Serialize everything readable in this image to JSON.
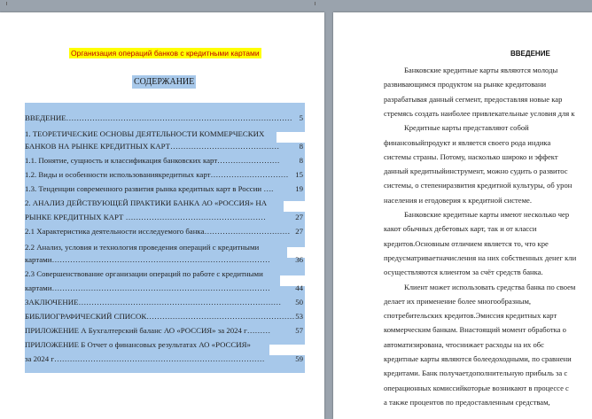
{
  "left_page": {
    "topic": "Организация операций банков с кредитными картами",
    "toc_heading": "СОДЕРЖАНИЕ",
    "toc": [
      {
        "text": "ВВЕДЕНИЕ……………………………………………………………………………",
        "page": "5"
      },
      {
        "text": "1. ТЕОРЕТИЧЕСКИЕ ОСНОВЫ ДЕЯТЕЛЬНОСТИ  КОММЕРЧЕСКИХ",
        "page": ""
      },
      {
        "text": "БАНКОВ НА РЫНКЕ КРЕДИТНЫХ КАРТ……………………………………",
        "page": "8"
      },
      {
        "text": "1.1. Понятие, сущность и классификация банковских карт……………………",
        "page": "8"
      },
      {
        "text": "1.2. Виды и особенности использованиякредитных карт…………………………",
        "page": "15"
      },
      {
        "text": "1.3. Тенденции современного развития рынка кредитных карт в России ….",
        "page": "19"
      },
      {
        "text": "2. АНАЛИЗ ДЕЙСТВУЮЩЕЙ ПРАКТИКИ БАНКА АО «РОССИЯ» НА",
        "page": ""
      },
      {
        "text": "РЫНКЕ КРЕДИТНЫХ КАРТ ………………………………………………",
        "page": "27"
      },
      {
        "text": "2.1 Характеристика деятельности исследуемого банка……………………………",
        "page": "27"
      },
      {
        "text": "2.2 Анализ, условия и технология проведения операций с кредитными",
        "page": ""
      },
      {
        "text": "картами…………………………………………………………………………",
        "page": "36"
      },
      {
        "text": "2.3 Совершенствование организации операций по работе с кредитными",
        "page": ""
      },
      {
        "text": "картами…………………………………………………………………………",
        "page": "44"
      },
      {
        "text": "ЗАКЛЮЧЕНИЕ……………………………………………………………………",
        "page": "50"
      },
      {
        "text": "БИБЛИОГРАФИЧЕСКИЙ СПИСОК…………………………………………………",
        "page": "53"
      },
      {
        "text": "ПРИЛОЖЕНИЕ А Бухгалтерский баланс АО «РОССИЯ» за 2024 г………",
        "page": "57"
      },
      {
        "text": "ПРИЛОЖЕНИЕ Б Отчет о финансовых результатах АО «РОССИЯ»",
        "page": ""
      },
      {
        "text": "за 2024 г………………………………………………………………………",
        "page": "59"
      }
    ]
  },
  "right_page": {
    "title": "ВВЕДЕНИЕ",
    "lines": [
      {
        "text": "Банковские  кредитные  карты  являются  молоды",
        "indent": true
      },
      {
        "text": "развивающимся  продуктом  на  рынке  кредитовани",
        "indent": false
      },
      {
        "text": "разрабатывая данный сегмент, предоставляя новые кар",
        "indent": false
      },
      {
        "text": "стремясь создать наиболее привлекательные условия для к",
        "indent": false
      },
      {
        "text": "Кредитные       карты       представляют       собой",
        "indent": true
      },
      {
        "text": "финансовыйпродукт  и  является  своего  рода  индика",
        "indent": false
      },
      {
        "text": "системы  страны.  Потому,  насколько  широко  и  эффект",
        "indent": false
      },
      {
        "text": "данный кредитныйинструмент, можно судить о развитос",
        "indent": false
      },
      {
        "text": "системы,  о  степениразвития кредитной культуры, об урон",
        "indent": false
      },
      {
        "text": "населения и егодоверия к кредитной системе.",
        "indent": false
      },
      {
        "text": "Банковские кредитные карты имеют несколько чер",
        "indent": true
      },
      {
        "text": "какот  обычных  дебетовых  карт,  так  и  от  класси",
        "indent": false
      },
      {
        "text": "кредитов.Основным  отличием  является  то,  что  кре",
        "indent": false
      },
      {
        "text": "предусматриваетначисления на них собственных денег кли",
        "indent": false
      },
      {
        "text": "осуществляются клиентом за счёт средств банка.",
        "indent": false
      },
      {
        "text": "Клиент может использовать средства банка по своем",
        "indent": true
      },
      {
        "text": "делает    их    применение    более    многообразным,",
        "indent": false
      },
      {
        "text": "спотребительских кредитов.Эмиссия кредитных карт",
        "indent": false
      },
      {
        "text": "коммерческим банкам. Внастоящий момент обработка о",
        "indent": false
      },
      {
        "text": "автоматизирована,  чтоснижает  расходы  на  их  обс",
        "indent": false
      },
      {
        "text": "кредитные карты являются болеедоходными, по сравнени",
        "indent": false
      },
      {
        "text": "кредитами. Банк получаетдополнительную прибыль за с",
        "indent": false
      },
      {
        "text": "операционных  комиссийкоторые  возникают в процессе с",
        "indent": false
      },
      {
        "text": "а  также  процентов  по  предоставленным  средствам,",
        "indent": false
      }
    ]
  }
}
